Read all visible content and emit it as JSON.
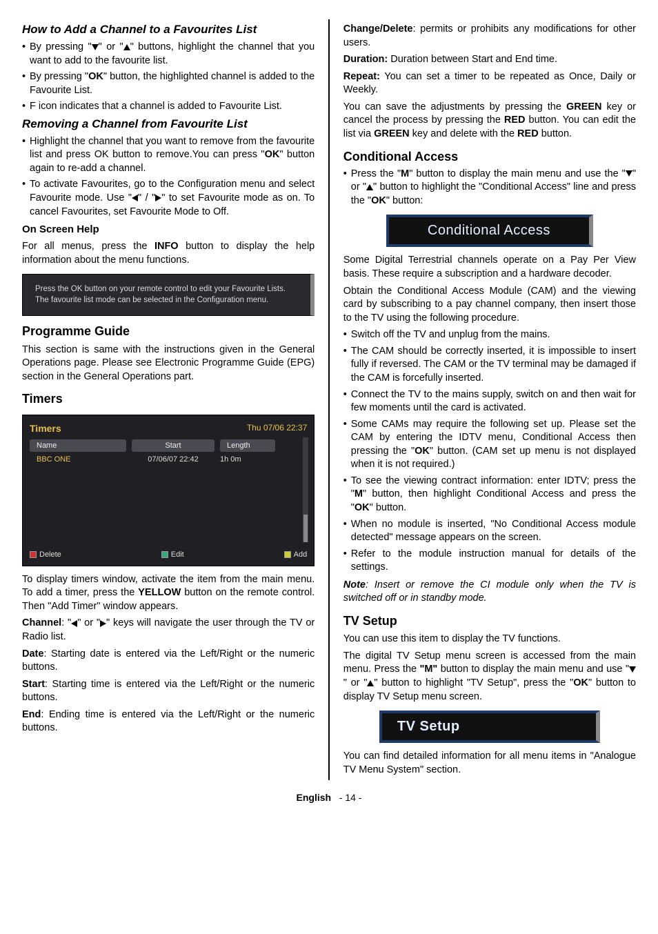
{
  "left": {
    "h_add": "How to Add a Channel to a Favourites List",
    "add_bullets": {
      "b1a": "By pressing \"",
      "b1b": "\" or \"",
      "b1c": "\" buttons, highlight the channel that you want to add to the favourite list.",
      "b2a": "By pressing \"",
      "b2b": "\" button, the highlighted channel is added to the Favourite List.",
      "b3": "F icon indicates that a channel is added  to Favourite List."
    },
    "ok": "OK",
    "h_remove": "Removing a Channel from Favourite List",
    "rem_bullets": {
      "r1a": "Highlight the channel that you want to remove from the favourite list and press OK button to remove.You can press \"",
      "r1b": "\" button again to re-add a channel.",
      "r2a": "To activate Favourites, go to the Configuration menu and select Favourite mode. Use \"",
      "r2b": "\" / \"",
      "r2c": "\" to set Favourite mode as on. To cancel Favourites, set Favourite Mode to Off."
    },
    "osh_h": "On Screen Help",
    "osh_p": "For all menus, press the ",
    "osh_info": "INFO",
    "osh_p2": " button to display the help information about the menu functions.",
    "help_box": "Press the OK button on your remote control to edit your Favourite Lists. The favourite list mode can be selected in the Configuration menu.",
    "pg_h": "Programme Guide",
    "pg_p": "This section is same with the instructions given in the General Operations page. Please see Electronic Programme Guide (EPG) section in the General Operations part.",
    "timers_h": "Timers",
    "timers_box": {
      "title": "Timers",
      "date": "Thu 07/06 22:37",
      "col_name": "Name",
      "col_start": "Start",
      "col_len": "Length",
      "row_name": "BBC ONE",
      "row_start": "07/06/07  22:42",
      "row_len": "1h 0m",
      "delete": "Delete",
      "edit": "Edit",
      "add": "Add"
    },
    "timers_p1a": "To display timers window, activate the item from the main menu. To add a timer, press the ",
    "timers_p1_yellow": "YELLOW",
    "timers_p1b": " button on the remote control. Then  \"Add Timer\" window appears.",
    "ch_lbl": "Channel",
    "ch_p": ": \"",
    "ch_mid": "\" or \"",
    "ch_end": "\" keys will navigate the user through the TV or Radio list.",
    "date_lbl": "Date",
    "date_p": ": Starting date is entered via the Left/Right or the numeric buttons.",
    "start_lbl": "Start",
    "start_p": ": Starting time is entered via the Left/Right or the numeric buttons.",
    "end_lbl": "End",
    "end_p": ": Ending time is entered via the Left/Right or the numeric buttons."
  },
  "right": {
    "cd_lbl": "Change/Delete",
    "cd_p": ": permits or prohibits any modifications for other users.",
    "dur_lbl": "Duration:",
    "dur_p": " Duration between Start and End time.",
    "rep_lbl": "Repeat:",
    "rep_p": " You can set a timer to be repeated as Once, Daily or Weekly.",
    "save_p1": "You can save the adjustments by pressing the ",
    "green": "GREEN",
    "save_p2": " key or cancel the process by pressing the ",
    "red": "RED",
    "save_p3": " button. You can edit the list via ",
    "save_p4": " key and delete with the ",
    "save_p5": " button.",
    "ca_h": "Conditional Access",
    "ca_b1a": "Press the \"",
    "m": "M",
    "ca_b1b": "\" button to display the main menu and use the \"",
    "ca_b1c": "\" or \"",
    "ca_b1d": "\" button to highlight the \"Conditional Access\" line and press the \"",
    "ca_b1e": "\" button:",
    "ca_bar": "Conditional Access",
    "ca_p1": "Some Digital Terrestrial channels operate on a Pay Per View basis. These require a subscription and a hardware decoder.",
    "ca_p2": "Obtain the Conditional Access Module (CAM) and the viewing card by subscribing to a pay channel company, then insert those to the TV using the following procedure.",
    "ca_l1": "Switch off the TV and unplug from the mains.",
    "ca_l2": "The CAM should be correctly inserted, it is impossible to insert fully if reversed. The CAM or the TV terminal may be damaged if the CAM is forcefully inserted.",
    "ca_l3": "Connect the TV to the mains supply, switch on and then wait for few moments until the card is activated.",
    "ca_l4a": "Some CAMs may require the following set up. Please set the CAM by entering the IDTV menu, Conditional Access then pressing the \"",
    "ca_l4b": "\" button. (CAM set up menu is not displayed when it is not required.)",
    "ca_l5a": "To see the viewing contract information: enter IDTV; press the \"",
    "ca_l5b": "\" button, then highlight Conditional Access and press the \"",
    "ca_l5c": "\" button.",
    "ca_l6": "When no module is inserted, \"No Conditional Access module detected\" message appears on the screen.",
    "ca_l7": "Refer to the module instruction manual for details of the settings.",
    "note_lbl": "Note",
    "note_p": ": Insert or remove the CI module only when the TV  is switched off or in standby mode.",
    "tv_h": "TV Setup",
    "tv_p1": "You can use this item to display the TV functions.",
    "tv_p2a": "The digital TV Setup menu screen is accessed from the main menu. Press the ",
    "tv_m": "\"M\"",
    "tv_p2b": " button to display the main menu and use \"",
    "tv_p2c": "\" or \"",
    "tv_p2d": "\" button to highlight \"TV Setup\", press the \"",
    "tv_p2e": "\" button to display TV Setup menu screen.",
    "tv_bar": "TV Setup",
    "tv_p3": "You can find detailed information for all menu items in \"Analogue TV Menu System\" section."
  },
  "footer": {
    "lang": "English",
    "page": "- 14 -"
  }
}
